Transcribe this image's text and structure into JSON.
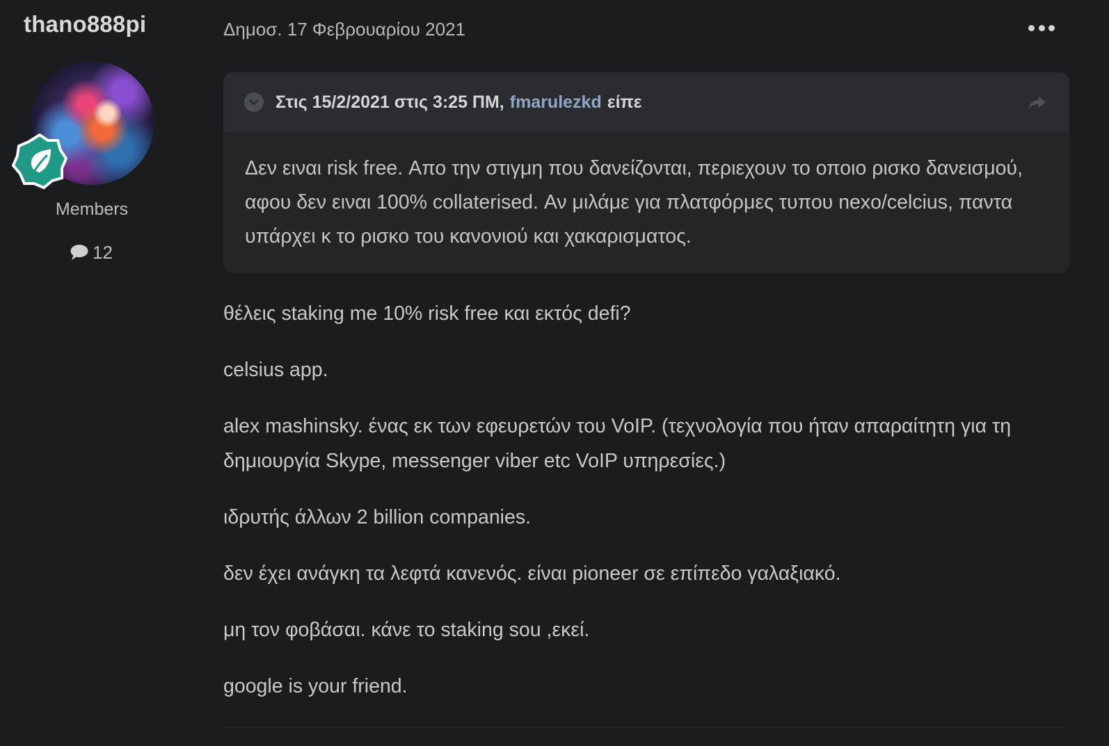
{
  "author": {
    "name": "thano888pi",
    "group": "Members",
    "post_count": "12"
  },
  "post": {
    "date": "Δημοσ. 17 Φεβρουαρίου 2021"
  },
  "quote": {
    "prefix": "Στις 15/2/2021 στις 3:25 ΠΜ,",
    "author": "fmarulezkd",
    "suffix": "είπε",
    "text": "Δεν ειναι risk free. Απο την στιγμη που δανείζονται, περιεχουν το οποιο ρισκο δανεισμού, αφου δεν ειναι 100% collaterised. Αν μιλάμε για πλατφόρμες τυπου nexo/celcius, παντα υπάρχει κ το ρισκο του κανονιού και χακαρισματος."
  },
  "paragraphs": [
    "θέλεις staking me 10% risk free και εκτός defi?",
    "celsius app.",
    "alex mashinsky. ένας εκ των εφευρετών του VoIP. (τεχνολογία που ήταν απαραίτητη για τη δημιουργία Skype, messenger viber etc VoIP υπηρεσίες.)",
    "ιδρυτής άλλων 2 billion companies.",
    "δεν έχει ανάγκη τα λεφτά κανενός. είναι pioneer σε επίπεδο γαλαξιακό.",
    "μη τον φοβάσαι. κάνε το staking sou ,εκεί.",
    "google is your friend."
  ],
  "icons": {
    "badge": "leaf-badge-icon",
    "comment": "comment-icon",
    "more": "ellipsis-icon",
    "toggle": "chevron-down-icon",
    "share": "share-arrow-icon"
  },
  "colors": {
    "background": "#1b1c1e",
    "quote_bg": "#232527",
    "link": "#8ea6c8",
    "badge": "#1f9a86"
  }
}
